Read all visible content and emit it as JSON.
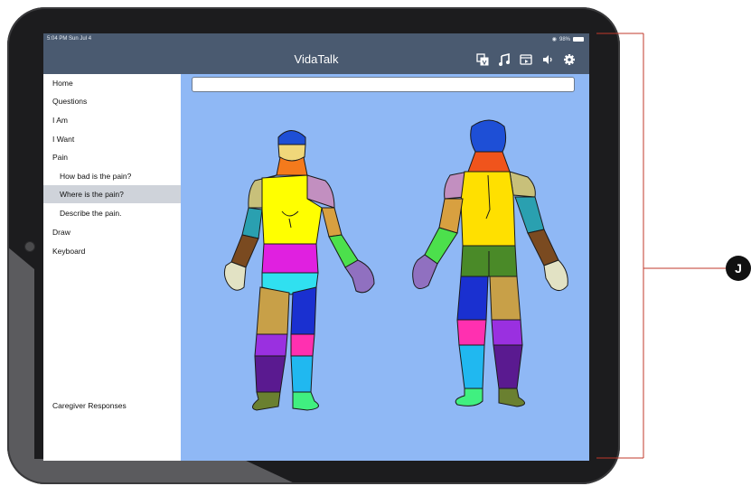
{
  "status": {
    "time": "5:04 PM  Sun Jul 4",
    "battery": "98%"
  },
  "app": {
    "title": "VidaTalk"
  },
  "toolbar": {
    "icons": [
      "translate-icon",
      "music-icon",
      "video-icon",
      "speaker-icon",
      "gear-icon"
    ]
  },
  "sidebar": {
    "items": [
      {
        "label": "Home",
        "level": "top"
      },
      {
        "label": "Questions",
        "level": "top"
      },
      {
        "label": "I Am",
        "level": "top"
      },
      {
        "label": "I Want",
        "level": "top"
      },
      {
        "label": "Pain",
        "level": "top"
      },
      {
        "label": "How bad is the pain?",
        "level": "sub"
      },
      {
        "label": "Where is the pain?",
        "level": "sub",
        "selected": true
      },
      {
        "label": "Describe the pain.",
        "level": "sub"
      },
      {
        "label": "Draw",
        "level": "top"
      },
      {
        "label": "Keyboard",
        "level": "top"
      }
    ],
    "footer_label": "Caregiver Responses"
  },
  "search": {
    "value": "",
    "placeholder": ""
  },
  "annotation": {
    "badge": "J"
  },
  "colors": {
    "navbar": "#4a5a70",
    "content_bg": "#8fb8f5",
    "selected_row": "#cfd3da",
    "bracket": "#c0392b"
  }
}
